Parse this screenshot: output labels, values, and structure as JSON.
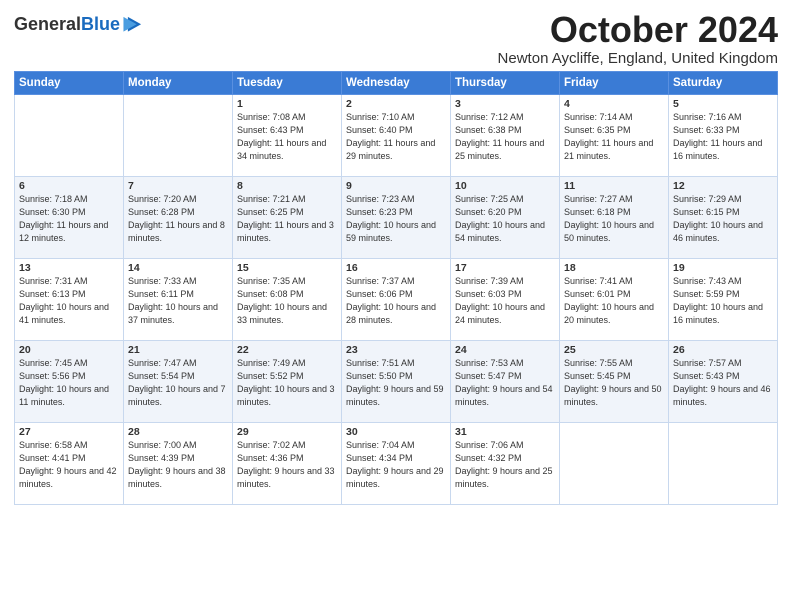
{
  "logo": {
    "general": "General",
    "blue": "Blue"
  },
  "header": {
    "month": "October 2024",
    "location": "Newton Aycliffe, England, United Kingdom"
  },
  "weekdays": [
    "Sunday",
    "Monday",
    "Tuesday",
    "Wednesday",
    "Thursday",
    "Friday",
    "Saturday"
  ],
  "weeks": [
    [
      null,
      null,
      {
        "day": 1,
        "sunrise": "7:08 AM",
        "sunset": "6:43 PM",
        "daylight": "11 hours and 34 minutes."
      },
      {
        "day": 2,
        "sunrise": "7:10 AM",
        "sunset": "6:40 PM",
        "daylight": "11 hours and 29 minutes."
      },
      {
        "day": 3,
        "sunrise": "7:12 AM",
        "sunset": "6:38 PM",
        "daylight": "11 hours and 25 minutes."
      },
      {
        "day": 4,
        "sunrise": "7:14 AM",
        "sunset": "6:35 PM",
        "daylight": "11 hours and 21 minutes."
      },
      {
        "day": 5,
        "sunrise": "7:16 AM",
        "sunset": "6:33 PM",
        "daylight": "11 hours and 16 minutes."
      }
    ],
    [
      {
        "day": 6,
        "sunrise": "7:18 AM",
        "sunset": "6:30 PM",
        "daylight": "11 hours and 12 minutes."
      },
      {
        "day": 7,
        "sunrise": "7:20 AM",
        "sunset": "6:28 PM",
        "daylight": "11 hours and 8 minutes."
      },
      {
        "day": 8,
        "sunrise": "7:21 AM",
        "sunset": "6:25 PM",
        "daylight": "11 hours and 3 minutes."
      },
      {
        "day": 9,
        "sunrise": "7:23 AM",
        "sunset": "6:23 PM",
        "daylight": "10 hours and 59 minutes."
      },
      {
        "day": 10,
        "sunrise": "7:25 AM",
        "sunset": "6:20 PM",
        "daylight": "10 hours and 54 minutes."
      },
      {
        "day": 11,
        "sunrise": "7:27 AM",
        "sunset": "6:18 PM",
        "daylight": "10 hours and 50 minutes."
      },
      {
        "day": 12,
        "sunrise": "7:29 AM",
        "sunset": "6:15 PM",
        "daylight": "10 hours and 46 minutes."
      }
    ],
    [
      {
        "day": 13,
        "sunrise": "7:31 AM",
        "sunset": "6:13 PM",
        "daylight": "10 hours and 41 minutes."
      },
      {
        "day": 14,
        "sunrise": "7:33 AM",
        "sunset": "6:11 PM",
        "daylight": "10 hours and 37 minutes."
      },
      {
        "day": 15,
        "sunrise": "7:35 AM",
        "sunset": "6:08 PM",
        "daylight": "10 hours and 33 minutes."
      },
      {
        "day": 16,
        "sunrise": "7:37 AM",
        "sunset": "6:06 PM",
        "daylight": "10 hours and 28 minutes."
      },
      {
        "day": 17,
        "sunrise": "7:39 AM",
        "sunset": "6:03 PM",
        "daylight": "10 hours and 24 minutes."
      },
      {
        "day": 18,
        "sunrise": "7:41 AM",
        "sunset": "6:01 PM",
        "daylight": "10 hours and 20 minutes."
      },
      {
        "day": 19,
        "sunrise": "7:43 AM",
        "sunset": "5:59 PM",
        "daylight": "10 hours and 16 minutes."
      }
    ],
    [
      {
        "day": 20,
        "sunrise": "7:45 AM",
        "sunset": "5:56 PM",
        "daylight": "10 hours and 11 minutes."
      },
      {
        "day": 21,
        "sunrise": "7:47 AM",
        "sunset": "5:54 PM",
        "daylight": "10 hours and 7 minutes."
      },
      {
        "day": 22,
        "sunrise": "7:49 AM",
        "sunset": "5:52 PM",
        "daylight": "10 hours and 3 minutes."
      },
      {
        "day": 23,
        "sunrise": "7:51 AM",
        "sunset": "5:50 PM",
        "daylight": "9 hours and 59 minutes."
      },
      {
        "day": 24,
        "sunrise": "7:53 AM",
        "sunset": "5:47 PM",
        "daylight": "9 hours and 54 minutes."
      },
      {
        "day": 25,
        "sunrise": "7:55 AM",
        "sunset": "5:45 PM",
        "daylight": "9 hours and 50 minutes."
      },
      {
        "day": 26,
        "sunrise": "7:57 AM",
        "sunset": "5:43 PM",
        "daylight": "9 hours and 46 minutes."
      }
    ],
    [
      {
        "day": 27,
        "sunrise": "6:58 AM",
        "sunset": "4:41 PM",
        "daylight": "9 hours and 42 minutes."
      },
      {
        "day": 28,
        "sunrise": "7:00 AM",
        "sunset": "4:39 PM",
        "daylight": "9 hours and 38 minutes."
      },
      {
        "day": 29,
        "sunrise": "7:02 AM",
        "sunset": "4:36 PM",
        "daylight": "9 hours and 33 minutes."
      },
      {
        "day": 30,
        "sunrise": "7:04 AM",
        "sunset": "4:34 PM",
        "daylight": "9 hours and 29 minutes."
      },
      {
        "day": 31,
        "sunrise": "7:06 AM",
        "sunset": "4:32 PM",
        "daylight": "9 hours and 25 minutes."
      },
      null,
      null
    ]
  ]
}
